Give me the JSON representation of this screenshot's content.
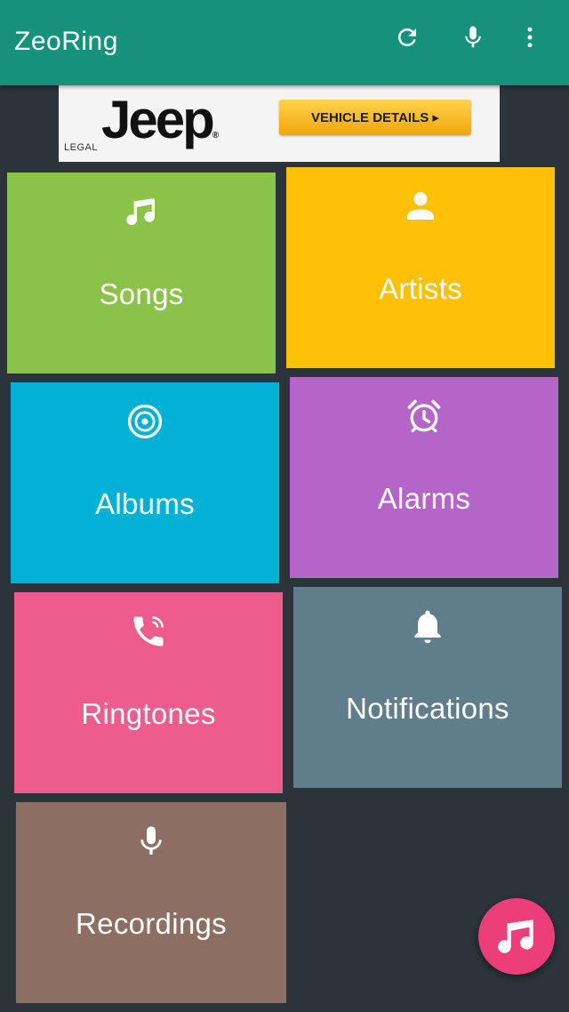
{
  "app": {
    "title": "ZeoRing",
    "actions": [
      {
        "name": "refresh",
        "icon": "refresh-icon"
      },
      {
        "name": "voice-search",
        "icon": "microphone-icon"
      },
      {
        "name": "overflow-menu",
        "icon": "more-vertical-icon"
      }
    ]
  },
  "ad": {
    "legal": "LEGAL",
    "brand": "Jeep",
    "trademark": "®",
    "cta": "VEHICLE DETAILS ▸"
  },
  "tiles": [
    {
      "label": "Songs",
      "icon": "music-note-icon",
      "color": "#8bc34a"
    },
    {
      "label": "Artists",
      "icon": "person-icon",
      "color": "#ffc107"
    },
    {
      "label": "Albums",
      "icon": "album-disc-icon",
      "color": "#03b1d6"
    },
    {
      "label": "Alarms",
      "icon": "alarm-clock-icon",
      "color": "#b565c8"
    },
    {
      "label": "Ringtones",
      "icon": "ringing-phone-icon",
      "color": "#ed5c8d"
    },
    {
      "label": "Notifications",
      "icon": "bell-icon",
      "color": "#607d8b"
    },
    {
      "label": "Recordings",
      "icon": "microphone-icon",
      "color": "#8d6e63"
    }
  ],
  "fab": {
    "icon": "music-notes-icon",
    "color": "#ec3f7a"
  },
  "colors": {
    "appbar": "#16917c",
    "background": "#2a3439"
  }
}
